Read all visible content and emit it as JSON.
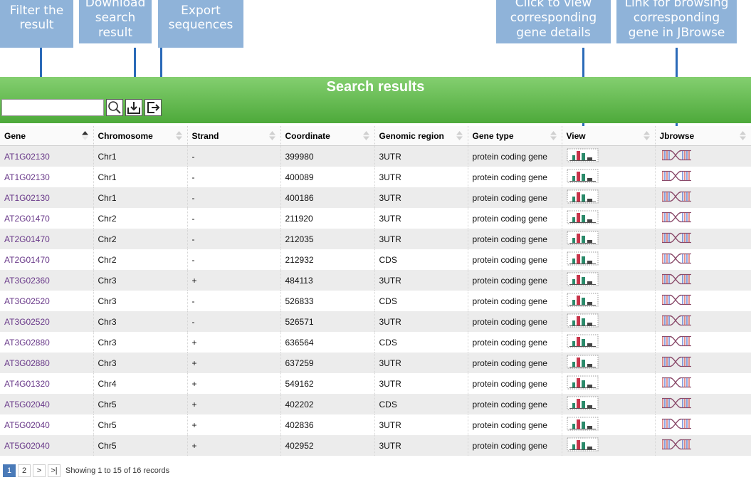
{
  "callouts": {
    "filter": "Filter the\nresult",
    "download": "Download\nsearch\nresult",
    "export": "Export\nsequences",
    "view": "Click to view\ncorresponding\ngene details",
    "jbrowse": "Link for browsing\ncorresponding\ngene in JBrowse"
  },
  "banner": {
    "title": "Search results",
    "filter_value": ""
  },
  "table": {
    "headers": [
      "Gene",
      "Chromosome",
      "Strand",
      "Coordinate",
      "Genomic region",
      "Gene type",
      "View",
      "Jbrowse"
    ],
    "rows": [
      {
        "gene": "AT1G02130",
        "chromosome": "Chr1",
        "strand": "-",
        "coordinate": "399980",
        "region": "3UTR",
        "type": "protein coding gene"
      },
      {
        "gene": "AT1G02130",
        "chromosome": "Chr1",
        "strand": "-",
        "coordinate": "400089",
        "region": "3UTR",
        "type": "protein coding gene"
      },
      {
        "gene": "AT1G02130",
        "chromosome": "Chr1",
        "strand": "-",
        "coordinate": "400186",
        "region": "3UTR",
        "type": "protein coding gene"
      },
      {
        "gene": "AT2G01470",
        "chromosome": "Chr2",
        "strand": "-",
        "coordinate": "211920",
        "region": "3UTR",
        "type": "protein coding gene"
      },
      {
        "gene": "AT2G01470",
        "chromosome": "Chr2",
        "strand": "-",
        "coordinate": "212035",
        "region": "3UTR",
        "type": "protein coding gene"
      },
      {
        "gene": "AT2G01470",
        "chromosome": "Chr2",
        "strand": "-",
        "coordinate": "212932",
        "region": "CDS",
        "type": "protein coding gene"
      },
      {
        "gene": "AT3G02360",
        "chromosome": "Chr3",
        "strand": "+",
        "coordinate": "484113",
        "region": "3UTR",
        "type": "protein coding gene"
      },
      {
        "gene": "AT3G02520",
        "chromosome": "Chr3",
        "strand": "-",
        "coordinate": "526833",
        "region": "CDS",
        "type": "protein coding gene"
      },
      {
        "gene": "AT3G02520",
        "chromosome": "Chr3",
        "strand": "-",
        "coordinate": "526571",
        "region": "3UTR",
        "type": "protein coding gene"
      },
      {
        "gene": "AT3G02880",
        "chromosome": "Chr3",
        "strand": "+",
        "coordinate": "636564",
        "region": "CDS",
        "type": "protein coding gene"
      },
      {
        "gene": "AT3G02880",
        "chromosome": "Chr3",
        "strand": "+",
        "coordinate": "637259",
        "region": "3UTR",
        "type": "protein coding gene"
      },
      {
        "gene": "AT4G01320",
        "chromosome": "Chr4",
        "strand": "+",
        "coordinate": "549162",
        "region": "3UTR",
        "type": "protein coding gene"
      },
      {
        "gene": "AT5G02040",
        "chromosome": "Chr5",
        "strand": "+",
        "coordinate": "402202",
        "region": "CDS",
        "type": "protein coding gene"
      },
      {
        "gene": "AT5G02040",
        "chromosome": "Chr5",
        "strand": "+",
        "coordinate": "402836",
        "region": "3UTR",
        "type": "protein coding gene"
      },
      {
        "gene": "AT5G02040",
        "chromosome": "Chr5",
        "strand": "+",
        "coordinate": "402952",
        "region": "3UTR",
        "type": "protein coding gene"
      }
    ]
  },
  "pagination": {
    "pages": [
      "1",
      "2"
    ],
    "next": ">",
    "last": ">|",
    "showing": "Showing 1 to 15 of 16 records"
  },
  "icons": {
    "search": "search-icon",
    "download": "download-icon",
    "export": "export-icon",
    "view": "bar-chart-view-icon",
    "jbrowse": "dna-jbrowse-icon"
  },
  "colors": {
    "banner": "#5db44a",
    "callout": "#8fb3d9",
    "arrow": "#2a6ab8",
    "gene_link": "#6a3a8a"
  }
}
